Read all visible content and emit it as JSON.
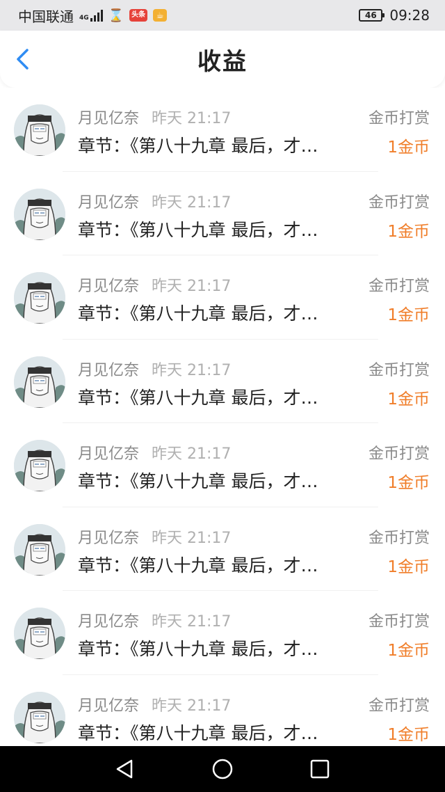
{
  "status_bar": {
    "carrier": "中国联通",
    "network": "4G",
    "app_badge": "头条",
    "battery": "46",
    "time": "09:28"
  },
  "header": {
    "title": "收益",
    "back_icon": "chevron-left-icon"
  },
  "colors": {
    "accent": "#2f8cf3",
    "amount": "#f07e2a",
    "muted": "#8a8a8a"
  },
  "rewards": [
    {
      "user": "月见亿奈",
      "time": "昨天 21:17",
      "type": "金币打赏",
      "chapter": "章节：《第八十九章 最后，才…",
      "amount": "1金币"
    },
    {
      "user": "月见亿奈",
      "time": "昨天 21:17",
      "type": "金币打赏",
      "chapter": "章节：《第八十九章 最后，才…",
      "amount": "1金币"
    },
    {
      "user": "月见亿奈",
      "time": "昨天 21:17",
      "type": "金币打赏",
      "chapter": "章节：《第八十九章 最后，才…",
      "amount": "1金币"
    },
    {
      "user": "月见亿奈",
      "time": "昨天 21:17",
      "type": "金币打赏",
      "chapter": "章节：《第八十九章 最后，才…",
      "amount": "1金币"
    },
    {
      "user": "月见亿奈",
      "time": "昨天 21:17",
      "type": "金币打赏",
      "chapter": "章节：《第八十九章 最后，才…",
      "amount": "1金币"
    },
    {
      "user": "月见亿奈",
      "time": "昨天 21:17",
      "type": "金币打赏",
      "chapter": "章节：《第八十九章 最后，才…",
      "amount": "1金币"
    },
    {
      "user": "月见亿奈",
      "time": "昨天 21:17",
      "type": "金币打赏",
      "chapter": "章节：《第八十九章 最后，才…",
      "amount": "1金币"
    },
    {
      "user": "月见亿奈",
      "time": "昨天 21:17",
      "type": "金币打赏",
      "chapter": "章节：《第八十九章 最后，才…",
      "amount": "1金币"
    }
  ],
  "system_nav": {
    "back": "triangle-back-icon",
    "home": "circle-home-icon",
    "recents": "square-recents-icon"
  }
}
